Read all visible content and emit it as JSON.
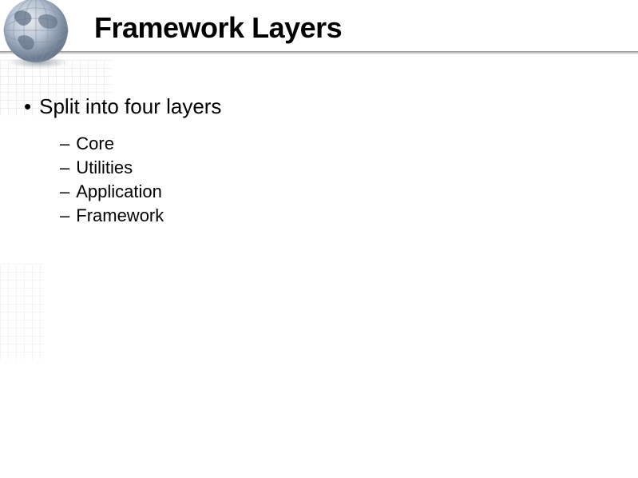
{
  "title": "Framework Layers",
  "main_bullet": "Split into four layers",
  "sub_items": {
    "0": "Core",
    "1": "Utilities",
    "2": "Application",
    "3": "Framework"
  }
}
